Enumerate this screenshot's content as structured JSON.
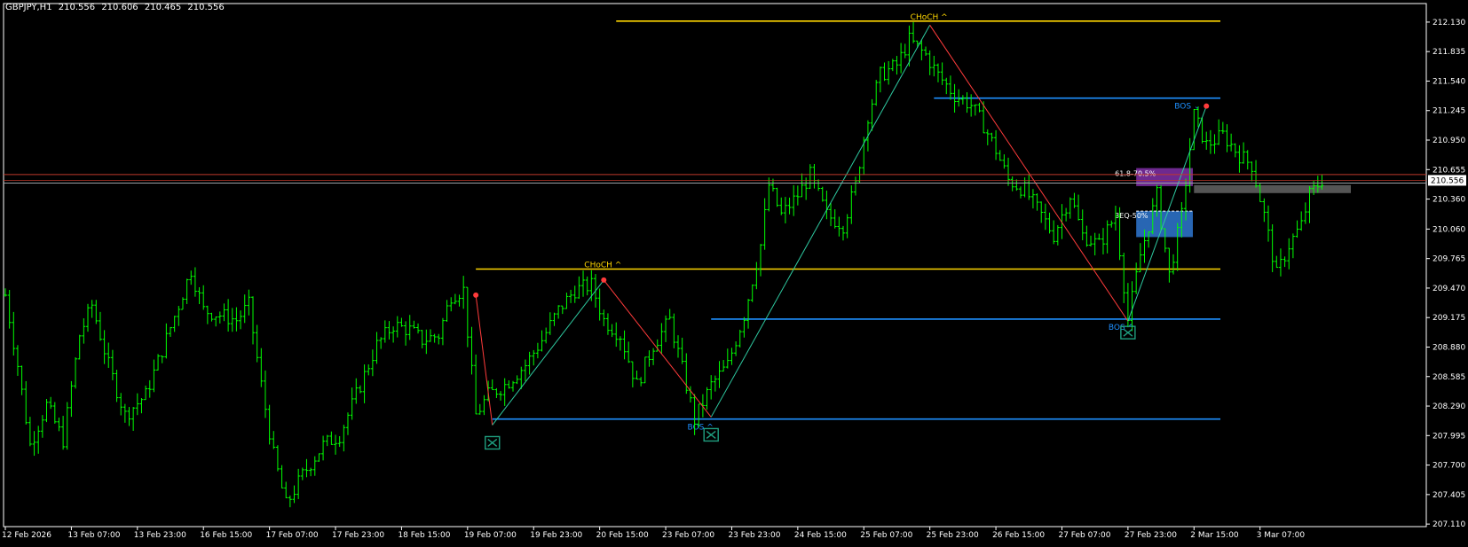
{
  "header": {
    "symbol_tf": "GBPJPY,H1",
    "open": "210.556",
    "high": "210.606",
    "low": "210.465",
    "close": "210.556"
  },
  "colors": {
    "background": "#000000",
    "frame": "#ffffff",
    "candle": "#00ff00",
    "choch": "#ffd700",
    "bos": "#1e90ff",
    "zigzag_up": "#2ec9a0",
    "zigzag_down": "#ff3b3b",
    "fib_zone": "#7a2e9e",
    "eq_zone": "#2a6bbd",
    "ask_line": "#c0392b",
    "bid_line": "#9aa0a6",
    "axis_text": "#ffffff",
    "marker": "#1f9f80"
  },
  "chart_data": {
    "type": "candlestick",
    "symbol": "GBPJPY",
    "timeframe": "H1",
    "ylim": [
      207.12,
      212.28
    ],
    "y_ticks": [
      "212.130",
      "211.835",
      "211.540",
      "211.245",
      "210.950",
      "210.655",
      "210.360",
      "210.060",
      "209.765",
      "209.470",
      "209.175",
      "208.880",
      "208.585",
      "208.290",
      "207.995",
      "207.700",
      "207.405",
      "207.110"
    ],
    "x_ticks": [
      "12 Feb 2026",
      "13 Feb 07:00",
      "13 Feb 23:00",
      "16 Feb 15:00",
      "17 Feb 07:00",
      "17 Feb 23:00",
      "18 Feb 15:00",
      "19 Feb 07:00",
      "19 Feb 23:00",
      "20 Feb 15:00",
      "23 Feb 07:00",
      "23 Feb 23:00",
      "24 Feb 15:00",
      "25 Feb 07:00",
      "25 Feb 23:00",
      "26 Feb 15:00",
      "27 Feb 07:00",
      "27 Feb 23:00",
      "2 Mar 15:00",
      "3 Mar 07:00"
    ],
    "x_tick_index": [
      0,
      16,
      32,
      48,
      64,
      80,
      96,
      112,
      128,
      144,
      160,
      176,
      192,
      208,
      224,
      240,
      256,
      272,
      288,
      304
    ],
    "n_bars": 320,
    "price_path": [
      [
        0,
        209.4
      ],
      [
        3,
        208.7
      ],
      [
        6,
        207.9
      ],
      [
        10,
        208.3
      ],
      [
        14,
        207.95
      ],
      [
        18,
        209.0
      ],
      [
        21,
        209.3
      ],
      [
        25,
        208.7
      ],
      [
        29,
        208.2
      ],
      [
        34,
        208.4
      ],
      [
        38,
        208.85
      ],
      [
        42,
        209.3
      ],
      [
        45,
        209.65
      ],
      [
        48,
        209.25
      ],
      [
        52,
        209.2
      ],
      [
        56,
        209.15
      ],
      [
        59,
        209.3
      ],
      [
        62,
        208.5
      ],
      [
        65,
        207.8
      ],
      [
        68,
        207.3
      ],
      [
        72,
        207.6
      ],
      [
        77,
        207.9
      ],
      [
        81,
        208.0
      ],
      [
        86,
        208.5
      ],
      [
        90,
        208.9
      ],
      [
        94,
        209.1
      ],
      [
        98,
        209.05
      ],
      [
        101,
        208.95
      ],
      [
        105,
        209.0
      ],
      [
        108,
        209.4
      ],
      [
        111,
        209.45
      ],
      [
        114,
        208.2
      ],
      [
        117,
        208.4
      ],
      [
        121,
        208.5
      ],
      [
        126,
        208.7
      ],
      [
        130,
        208.95
      ],
      [
        134,
        209.25
      ],
      [
        138,
        209.45
      ],
      [
        142,
        209.5
      ],
      [
        145,
        209.15
      ],
      [
        149,
        209.0
      ],
      [
        153,
        208.5
      ],
      [
        157,
        208.9
      ],
      [
        161,
        209.15
      ],
      [
        165,
        208.5
      ],
      [
        167,
        208.15
      ],
      [
        171,
        208.5
      ],
      [
        175,
        208.7
      ],
      [
        179,
        209.2
      ],
      [
        183,
        209.9
      ],
      [
        185,
        210.5
      ],
      [
        188,
        210.2
      ],
      [
        192,
        210.4
      ],
      [
        195,
        210.6
      ],
      [
        199,
        210.2
      ],
      [
        203,
        210.1
      ],
      [
        206,
        210.5
      ],
      [
        209,
        211.2
      ],
      [
        212,
        211.6
      ],
      [
        216,
        211.7
      ],
      [
        219,
        211.95
      ],
      [
        223,
        211.8
      ],
      [
        226,
        211.6
      ],
      [
        230,
        211.4
      ],
      [
        234,
        211.3
      ],
      [
        237,
        211.1
      ],
      [
        240,
        210.85
      ],
      [
        243,
        210.55
      ],
      [
        247,
        210.45
      ],
      [
        251,
        210.2
      ],
      [
        254,
        210.0
      ],
      [
        258,
        210.4
      ],
      [
        261,
        210.0
      ],
      [
        265,
        209.9
      ],
      [
        269,
        210.2
      ],
      [
        272,
        209.15
      ],
      [
        275,
        209.8
      ],
      [
        279,
        210.4
      ],
      [
        282,
        209.6
      ],
      [
        285,
        210.2
      ],
      [
        288,
        211.2
      ],
      [
        291,
        210.9
      ],
      [
        295,
        211.0
      ],
      [
        299,
        210.8
      ],
      [
        302,
        210.7
      ],
      [
        305,
        210.2
      ],
      [
        308,
        209.6
      ],
      [
        311,
        209.9
      ],
      [
        314,
        210.1
      ],
      [
        316,
        210.4
      ],
      [
        319,
        210.556
      ]
    ],
    "levels": [
      {
        "label": "CHoCH ^",
        "kind": "choch",
        "price": 212.14,
        "from": 148,
        "to": 320,
        "label_at": 224
      },
      {
        "label": "BOS ⌄",
        "kind": "bos",
        "price": 211.37,
        "from": 225,
        "to": 320,
        "label_at": 288
      },
      {
        "label": "CHoCH ^",
        "kind": "choch",
        "price": 209.66,
        "from": 114,
        "to": 320,
        "label_at": 145
      },
      {
        "label": "BOS ^",
        "kind": "bos",
        "price": 209.16,
        "from": 171,
        "to": 320,
        "label_at": 272
      },
      {
        "label": "BOS ^",
        "kind": "bos",
        "price": 208.16,
        "from": 118,
        "to": 320,
        "label_at": 170
      }
    ],
    "zones": [
      {
        "label": "61.8-70.5%",
        "kind": "fib",
        "top": 210.67,
        "bottom": 210.49,
        "from": 274,
        "to": 335
      },
      {
        "label": "3EQ-50%",
        "kind": "eq",
        "top": 210.24,
        "bottom": 209.98,
        "from": 274,
        "to": 335
      }
    ],
    "small_zone": {
      "top": 210.5,
      "bottom": 210.42,
      "from": 288,
      "to": 326
    },
    "zigzag": [
      [
        114,
        209.4,
        118,
        208.1,
        "down"
      ],
      [
        118,
        208.1,
        145,
        209.55,
        "up"
      ],
      [
        145,
        209.55,
        171,
        208.18,
        "down"
      ],
      [
        171,
        208.18,
        224,
        212.1,
        "up"
      ],
      [
        224,
        212.1,
        272,
        209.14,
        "down"
      ],
      [
        272,
        209.14,
        291,
        211.29,
        "up"
      ]
    ],
    "markers_x": [
      118,
      171,
      272
    ],
    "current_price": 210.556,
    "current_price_label": "210.556",
    "ask_price": 210.605
  }
}
